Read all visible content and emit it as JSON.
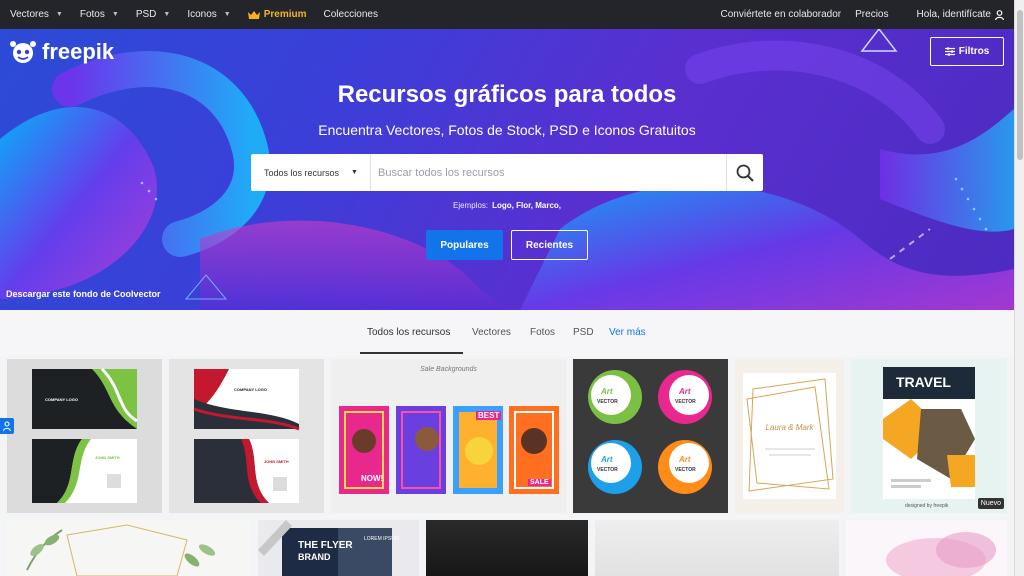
{
  "topnav": {
    "items": [
      {
        "label": "Vectores"
      },
      {
        "label": "Fotos"
      },
      {
        "label": "PSD"
      },
      {
        "label": "Iconos"
      }
    ],
    "premium": "Premium",
    "collections": "Colecciones",
    "contributor": "Conviértete en colaborador",
    "pricing": "Precios",
    "login": "Hola, identifícate"
  },
  "hero": {
    "logo": "freepik",
    "filters": "Filtros",
    "title": "Recursos gráficos para todos",
    "subtitle": "Encuentra Vectores, Fotos de Stock, PSD e Iconos Gratuitos",
    "search_type": "Todos los recursos",
    "search_placeholder": "Buscar todos los recursos",
    "examples_label": "Ejemplos:",
    "examples": "Logo, Flor, Marco,",
    "popular": "Populares",
    "recent": "Recientes",
    "credit": "Descargar este fondo de Coolvector"
  },
  "tabs": {
    "all": "Todos los recursos",
    "vectors": "Vectores",
    "photos": "Fotos",
    "psd": "PSD",
    "more": "Ver más"
  },
  "cards": {
    "bc1_company": "COMPANY LOGO",
    "bc1_name": "JOHN SMITH",
    "bc2_company": "COMPANY LOGO",
    "bc2_name": "JOHN SMITH",
    "sale_title": "Sale Backgrounds",
    "sale_best": "BEST",
    "sale_now": "NOW!",
    "sale_sale": "SALE",
    "art_label": "Art",
    "vector_label": "VECTOR",
    "wedding_names": "Laura & Mark",
    "travel_title": "TRAVEL",
    "travel_credit": "designed by freepik",
    "new_badge": "Nuevo",
    "flyer_title": "THE FLYER",
    "flyer_sub": "BRAND",
    "flyer_lorem": "LOREM IPSUM"
  }
}
